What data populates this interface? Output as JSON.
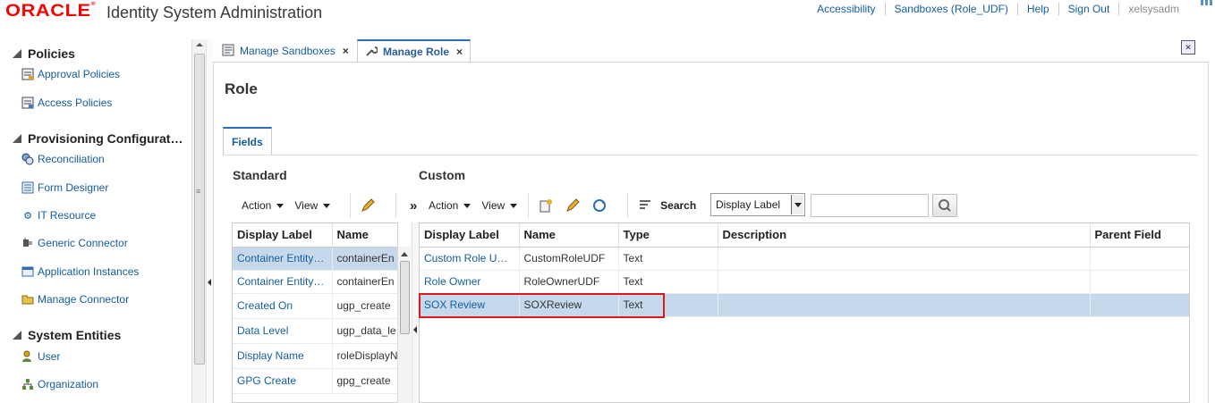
{
  "header": {
    "logo": "ORACLE",
    "app_title": "Identity System Administration",
    "links": [
      "Accessibility",
      "Sandboxes (Role_UDF)",
      "Help",
      "Sign Out"
    ],
    "user": "xelsysadm"
  },
  "leftnav": {
    "sections": [
      {
        "title": "Policies",
        "items": [
          {
            "label": "Approval Policies",
            "icon": "approval-policy-icon"
          },
          {
            "label": "Access Policies",
            "icon": "access-policy-icon"
          }
        ]
      },
      {
        "title": "Provisioning Configurat…",
        "items": [
          {
            "label": "Reconciliation",
            "icon": "reconciliation-icon"
          },
          {
            "label": "Form Designer",
            "icon": "form-designer-icon"
          },
          {
            "label": "IT Resource",
            "icon": "gear-icon"
          },
          {
            "label": "Generic Connector",
            "icon": "connector-icon"
          },
          {
            "label": "Application Instances",
            "icon": "application-icon"
          },
          {
            "label": "Manage Connector",
            "icon": "folder-icon"
          }
        ]
      },
      {
        "title": "System Entities",
        "items": [
          {
            "label": "User",
            "icon": "user-icon"
          },
          {
            "label": "Organization",
            "icon": "organization-icon"
          }
        ]
      }
    ]
  },
  "tabs": [
    {
      "label": "Manage Sandboxes",
      "icon": "sandbox-icon",
      "active": false
    },
    {
      "label": "Manage Role",
      "icon": "wrench-icon",
      "active": true
    }
  ],
  "page": {
    "title": "Role",
    "subtab": "Fields"
  },
  "standard": {
    "title": "Standard",
    "toolbar": {
      "action": "Action",
      "view": "View"
    },
    "columns": [
      "Display Label",
      "Name"
    ],
    "rows": [
      [
        "Container Entity…",
        "containerEn"
      ],
      [
        "Container Entity…",
        "containerEn"
      ],
      [
        "Created On",
        "ugp_create"
      ],
      [
        "Data Level",
        "ugp_data_le"
      ],
      [
        "Display Name",
        "roleDisplayN"
      ],
      [
        "GPG Create",
        "gpg_create"
      ]
    ]
  },
  "custom": {
    "title": "Custom",
    "toolbar": {
      "action": "Action",
      "view": "View",
      "search_label": "Search",
      "search_field": "Display Label",
      "search_value": ""
    },
    "columns": [
      "Display Label",
      "Name",
      "Type",
      "Description",
      "Parent Field"
    ],
    "rows": [
      [
        "Custom Role U…",
        "CustomRoleUDF",
        "Text",
        "",
        ""
      ],
      [
        "Role Owner",
        "RoleOwnerUDF",
        "Text",
        "",
        ""
      ],
      [
        "SOX Review",
        "SOXReview",
        "Text",
        "",
        ""
      ]
    ],
    "selected_row": 2
  },
  "colors": {
    "link": "#145c9e",
    "accent": "#2a6ebb",
    "selected_row": "#c6d9ec",
    "highlight": "#e0161f",
    "oracle_red": "#f80000"
  }
}
